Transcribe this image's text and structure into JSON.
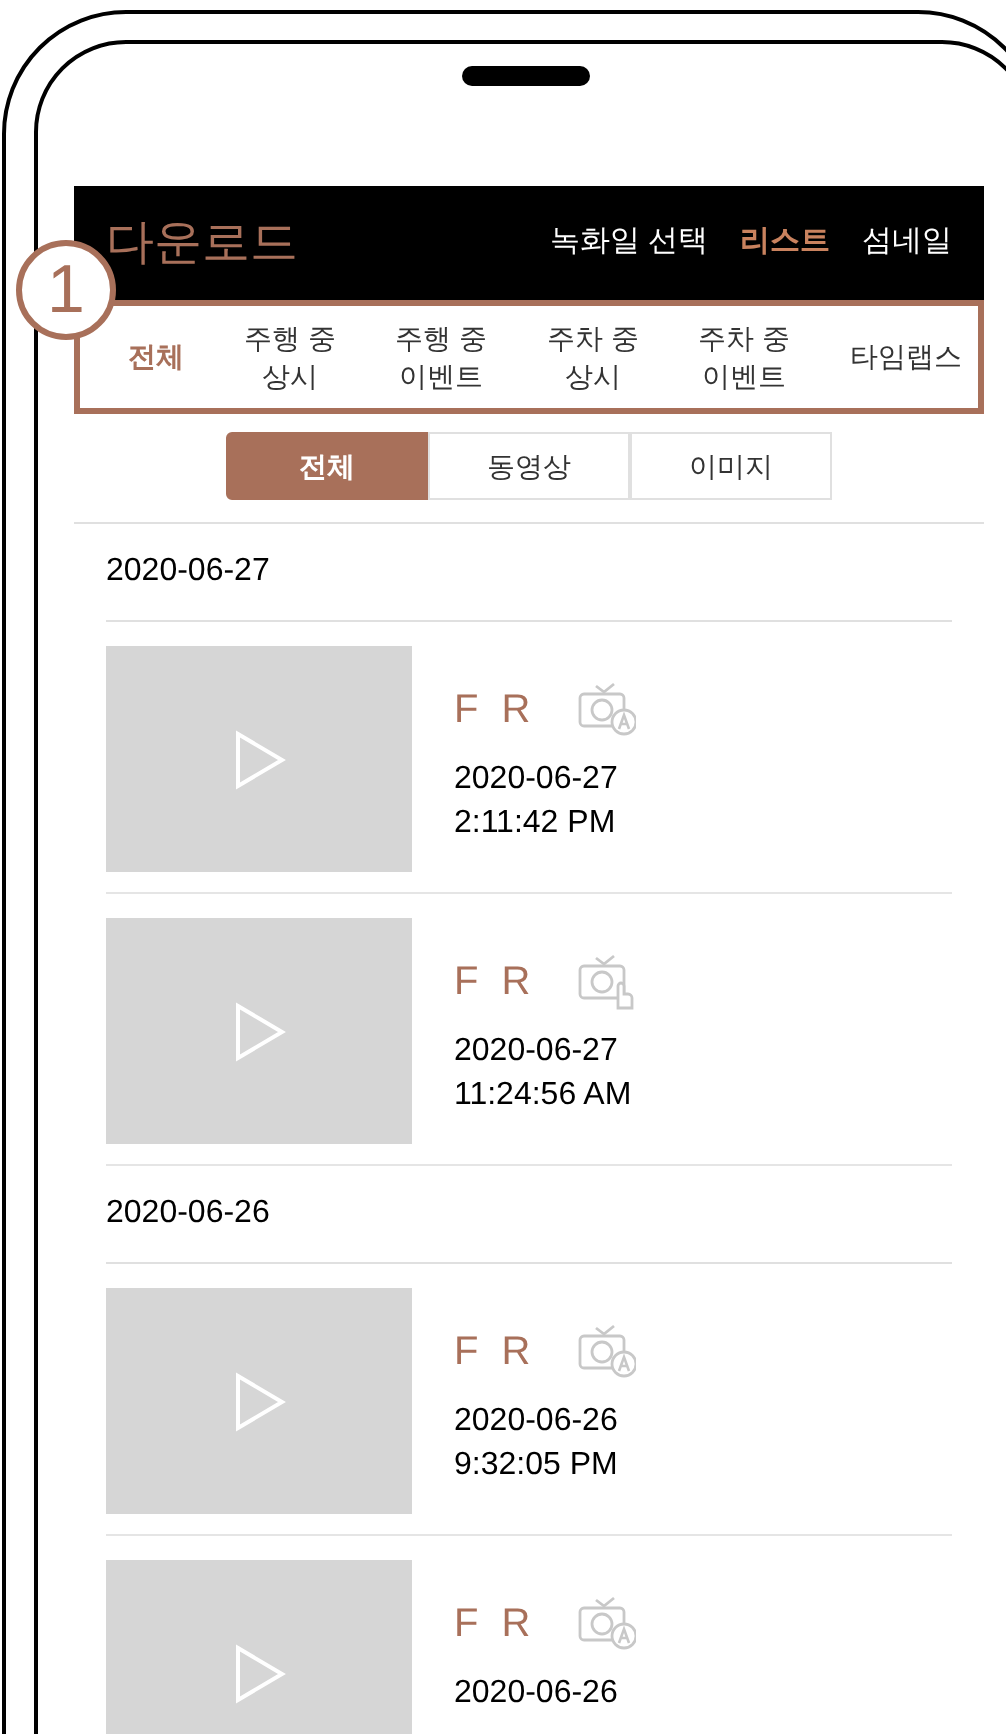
{
  "header": {
    "title": "다운로드",
    "nav": [
      {
        "label": "녹화일 선택",
        "selected": false
      },
      {
        "label": "리스트",
        "selected": true
      },
      {
        "label": "섬네일",
        "selected": false
      }
    ]
  },
  "callout": "1",
  "categories": [
    {
      "label": "전체",
      "selected": true
    },
    {
      "label": "주행 중\n상시",
      "selected": false
    },
    {
      "label": "주행 중\n이벤트",
      "selected": false
    },
    {
      "label": "주차 중\n상시",
      "selected": false
    },
    {
      "label": "주차 중\n이벤트",
      "selected": false
    },
    {
      "label": "타임랩스",
      "selected": false
    }
  ],
  "filter": [
    {
      "label": "전체",
      "selected": true
    },
    {
      "label": "동영상",
      "selected": false
    },
    {
      "label": "이미지",
      "selected": false
    }
  ],
  "sections": [
    {
      "date": "2020-06-27",
      "items": [
        {
          "channels": "F R",
          "kind": "auto",
          "date": "2020-06-27",
          "time": "2:11:42 PM"
        },
        {
          "channels": "F R",
          "kind": "manual",
          "date": "2020-06-27",
          "time": "11:24:56 AM"
        }
      ]
    },
    {
      "date": "2020-06-26",
      "items": [
        {
          "channels": "F R",
          "kind": "auto",
          "date": "2020-06-26",
          "time": "9:32:05 PM"
        },
        {
          "channels": "F R",
          "kind": "auto",
          "date": "2020-06-26"
        }
      ]
    }
  ]
}
